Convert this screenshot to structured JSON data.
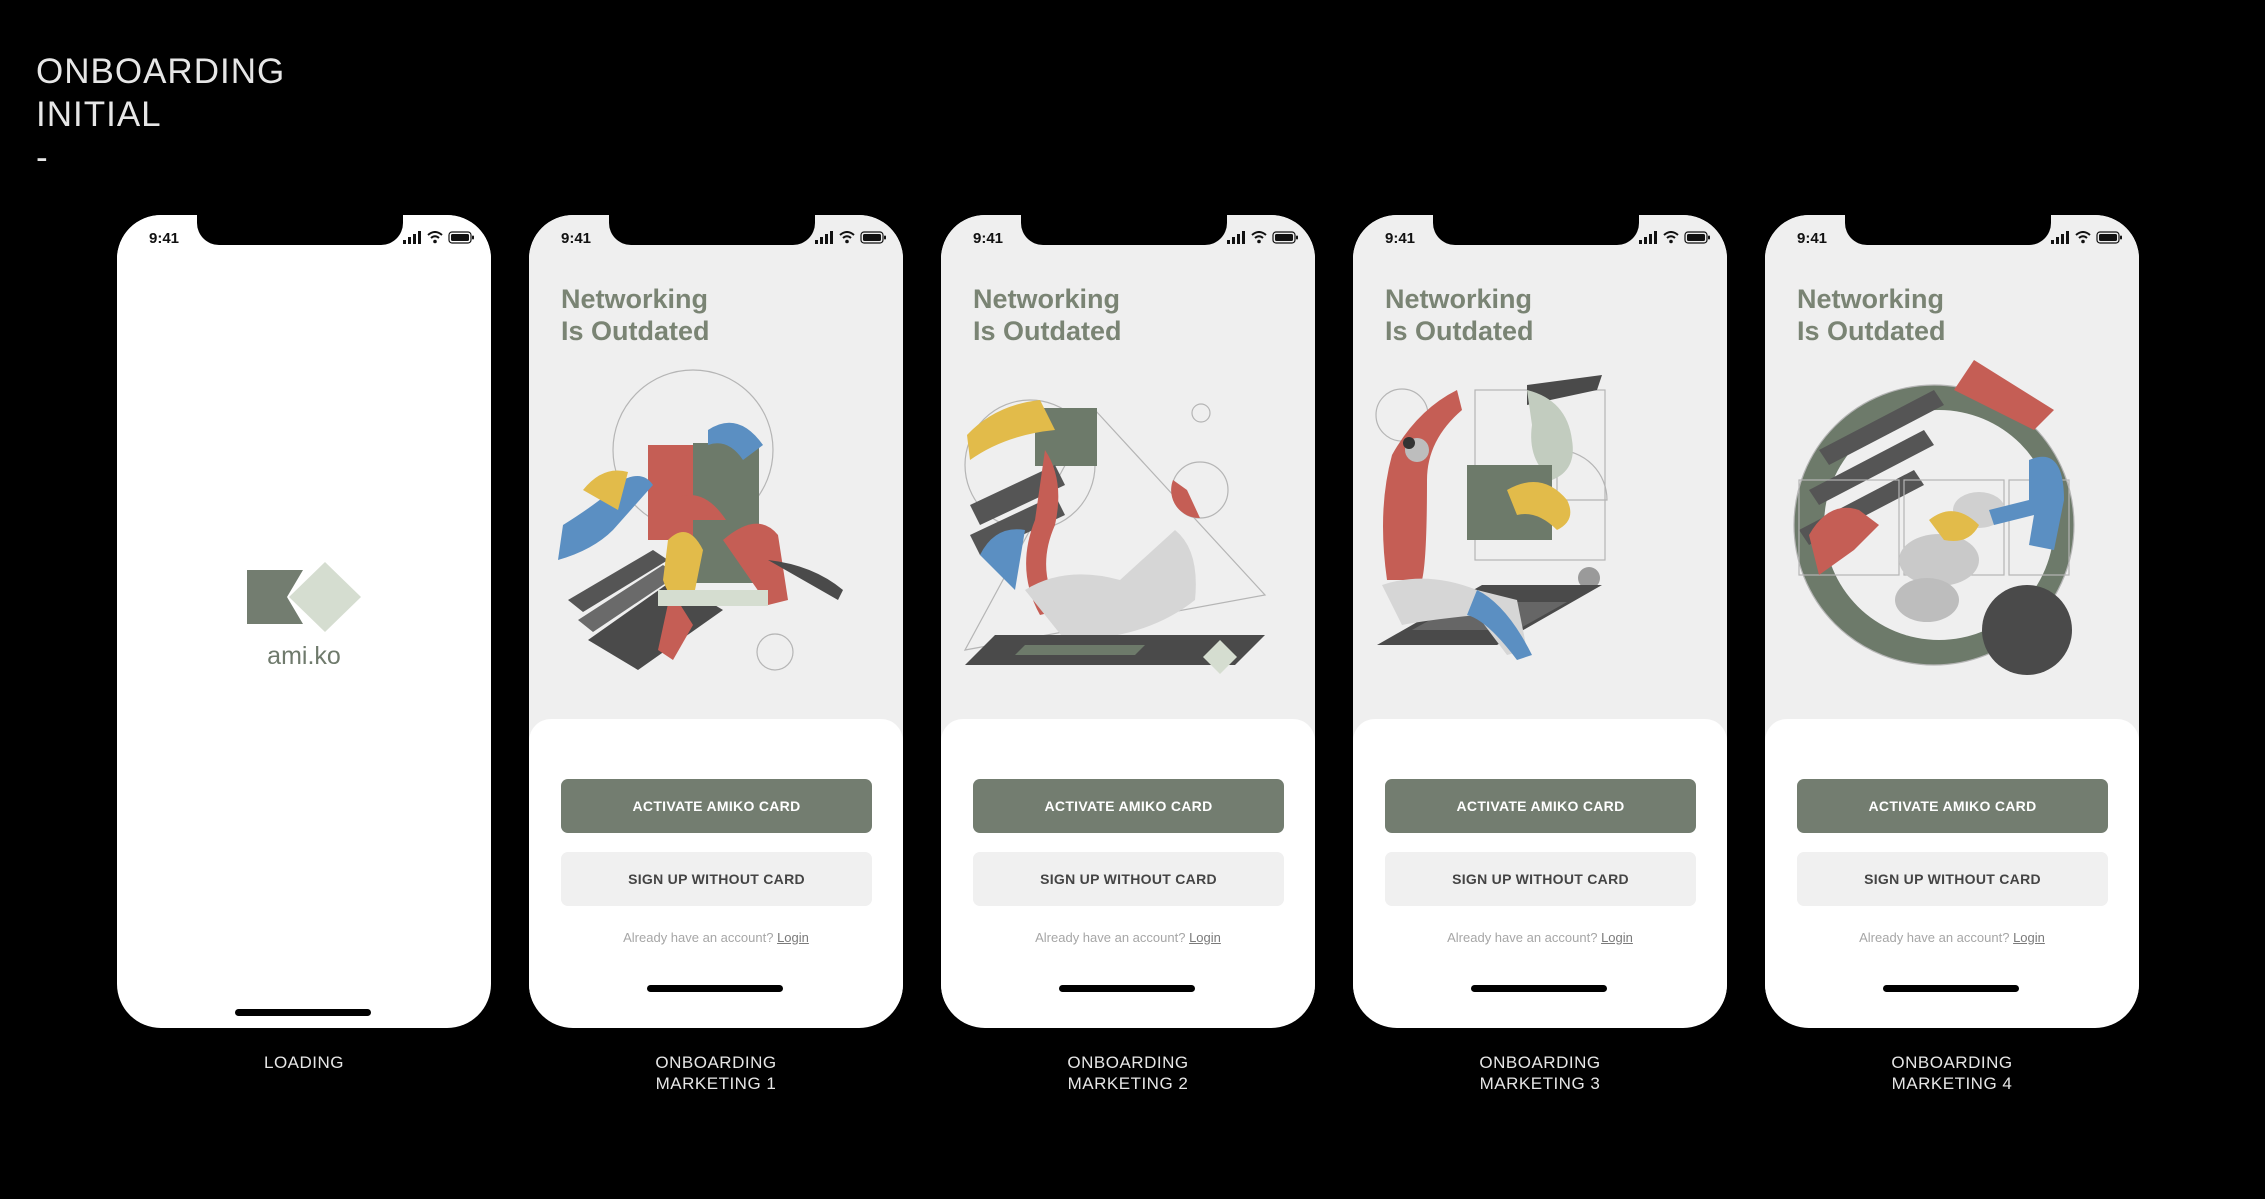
{
  "board": {
    "title_line1": "ONBOARDING",
    "title_line2": "INITIAL",
    "title_dash": "-"
  },
  "status_bar": {
    "time": "9:41"
  },
  "loading": {
    "logo_text": "ami.ko",
    "caption": "LOADING"
  },
  "marketing": {
    "headline_line1": "Networking",
    "headline_line2": "Is Outdated",
    "primary_button": "ACTIVATE AMIKO CARD",
    "secondary_button": "SIGN UP WITHOUT CARD",
    "login_prompt": "Already have an account?",
    "login_link": "Login"
  },
  "screens": [
    {
      "caption_line1": "ONBOARDING",
      "caption_line2": "MARKETING 1",
      "active_page": 1
    },
    {
      "caption_line1": "ONBOARDING",
      "caption_line2": "MARKETING 2",
      "active_page": 2
    },
    {
      "caption_line1": "ONBOARDING",
      "caption_line2": "MARKETING 3",
      "active_page": 3
    },
    {
      "caption_line1": "ONBOARDING",
      "caption_line2": "MARKETING 4",
      "active_page": 4
    }
  ],
  "colors": {
    "sage": "#737d70",
    "light_sage": "#d5ddd0",
    "red": "#c55e55",
    "yellow": "#e2bb4a",
    "blue": "#5b8fc2",
    "dark_grey": "#4a4a4a"
  },
  "icons": [
    "signal-icon",
    "wifi-icon",
    "battery-icon",
    "amiko-logo-icon"
  ]
}
